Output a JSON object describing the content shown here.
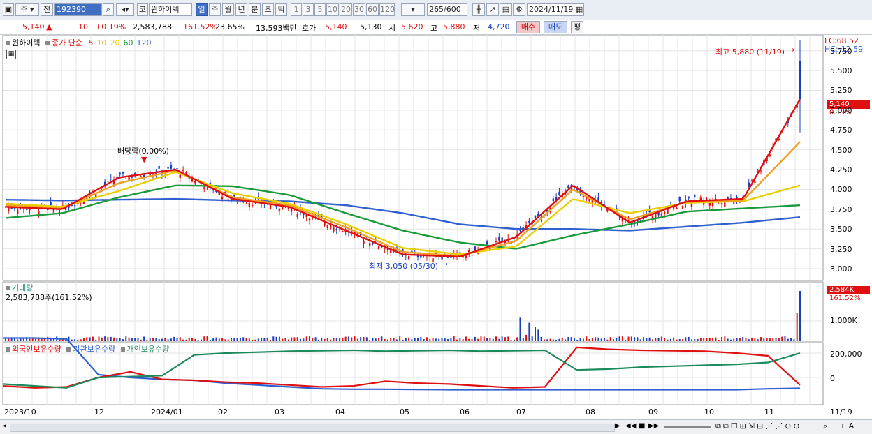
{
  "toolbar": {
    "period_buttons": [
      "일",
      "주",
      "월",
      "년",
      "분",
      "초",
      "틱"
    ],
    "active_period": "일",
    "interval_buttons": [
      "1",
      "3",
      "5",
      "10",
      "20",
      "30",
      "60",
      "120"
    ],
    "market_button": "주",
    "prev_button": "전",
    "code": "192390",
    "market_tag": "코",
    "stock_name": "윈하이텍",
    "count_value": "265",
    "count_total": "/600",
    "date": "2024/11/19"
  },
  "quote": {
    "price": "5,140",
    "change_arrow": "▲",
    "change": "10",
    "change_pct": "+0.19%",
    "volume": "2,583,788",
    "volume_ratio": "161.52%",
    "turnover": "23.65%",
    "amount": "13,593백만",
    "hoga_label": "호가",
    "ask": "5,140",
    "bid": "5,130",
    "open_label": "시",
    "open": "5,620",
    "high_label": "고",
    "high": "5,880",
    "low_label": "저",
    "low": "4,720",
    "buy_button": "매수",
    "sell_button": "매도",
    "flat_button": "평"
  },
  "price_panel": {
    "stock_label": "윈하이텍",
    "ma_label": "종가 단순",
    "ma_periods": [
      {
        "label": "5",
        "color": "#e01010"
      },
      {
        "label": "10",
        "color": "#f0a020"
      },
      {
        "label": "20",
        "color": "#e8d000"
      },
      {
        "label": "60",
        "color": "#1a9a3a"
      },
      {
        "label": "120",
        "color": "#3060d0"
      }
    ],
    "lc": "LC:68.52",
    "hc": "HC:-12.59",
    "high_annotation": "최고 5,880 (11/19)",
    "low_annotation": "최저 3,050 (05/30)",
    "dividend_annotation": "배당락(0.00%)",
    "last_price_tag": "5,140",
    "last_change_tag": "0.19%",
    "y_ticks": [
      "5,750",
      "5,500",
      "5,250",
      "5,000",
      "4,750",
      "4,500",
      "4,250",
      "4,000",
      "3,750",
      "3,500",
      "3,250",
      "3,000"
    ]
  },
  "volume_panel": {
    "label": "거래량",
    "value": "2,583,788주(161.52%)",
    "tag_value": "2,584K",
    "tag_pct": "161.52%",
    "y_ticks": [
      "1,000K"
    ]
  },
  "holding_panel": {
    "series": [
      "외국인보유수량",
      "기관보유수량",
      "개인보유수량"
    ],
    "y_ticks": [
      "200,000",
      "0"
    ]
  },
  "x_axis": [
    "2023/10",
    "12",
    "2024/01",
    "02",
    "03",
    "04",
    "05",
    "06",
    "07",
    "08",
    "09",
    "10",
    "11",
    "11/19"
  ],
  "chart_data": [
    {
      "type": "line",
      "title": "",
      "ylim": [
        2850,
        5950
      ],
      "months": [
        "2023/10",
        "11",
        "12",
        "2024/01",
        "02",
        "03",
        "04",
        "05",
        "06",
        "07",
        "08",
        "09",
        "10",
        "11"
      ],
      "series": [
        {
          "name": "5",
          "color": "#e01010",
          "values": [
            3780,
            3750,
            4150,
            4250,
            3880,
            3780,
            3480,
            3180,
            3150,
            3400,
            4050,
            3580,
            3850,
            3880,
            5140
          ]
        },
        {
          "name": "10",
          "color": "#f0a020",
          "values": [
            3800,
            3760,
            4080,
            4240,
            3900,
            3800,
            3520,
            3210,
            3160,
            3350,
            4000,
            3620,
            3840,
            3860,
            4600
          ]
        },
        {
          "name": "20",
          "color": "#e8d000",
          "values": [
            3820,
            3780,
            3980,
            4220,
            3950,
            3820,
            3560,
            3260,
            3180,
            3280,
            3880,
            3700,
            3830,
            3850,
            4050
          ]
        },
        {
          "name": "60",
          "color": "#1a9a3a",
          "values": [
            3640,
            3700,
            3900,
            4050,
            4040,
            3930,
            3700,
            3480,
            3330,
            3250,
            3420,
            3560,
            3720,
            3760,
            3800
          ]
        },
        {
          "name": "120",
          "color": "#3060d0",
          "values": [
            3870,
            3860,
            3870,
            3880,
            3860,
            3850,
            3800,
            3700,
            3560,
            3500,
            3500,
            3480,
            3530,
            3580,
            3650
          ]
        }
      ]
    }
  ]
}
